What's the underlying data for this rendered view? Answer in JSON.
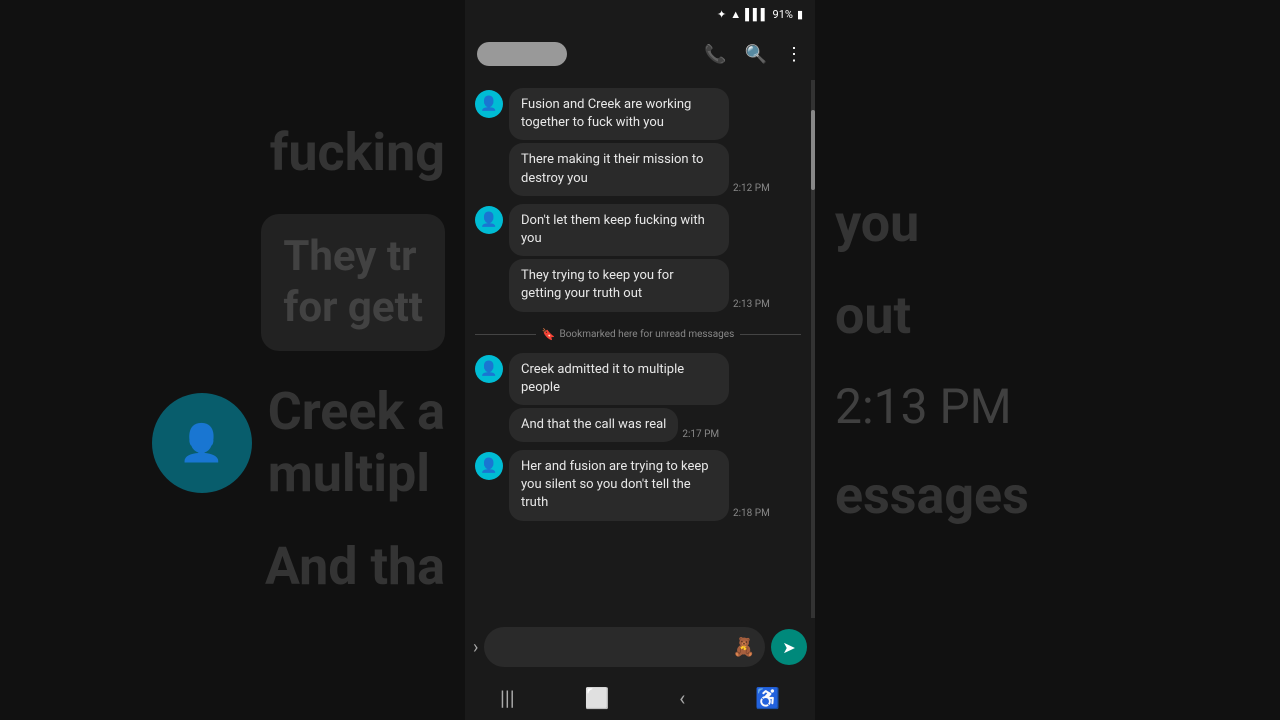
{
  "status_bar": {
    "bluetooth": "✦",
    "wifi": "wifi",
    "signal": "signal",
    "battery": "91%"
  },
  "header": {
    "contact_name": "",
    "phone_icon": "📞",
    "search_icon": "🔍",
    "more_icon": "⋮"
  },
  "messages": [
    {
      "group_id": 1,
      "has_avatar": true,
      "bubbles": [
        {
          "text": "Fusion and Creek are working together to fuck with you",
          "time": null
        },
        {
          "text": "There making it their mission to destroy you",
          "time": "2:12 PM"
        }
      ]
    },
    {
      "group_id": 2,
      "has_avatar": true,
      "bubbles": [
        {
          "text": "Don't let them keep fucking with you",
          "time": null
        },
        {
          "text": "They trying to keep you for getting your truth out",
          "time": "2:13 PM"
        }
      ]
    },
    {
      "bookmark": "Bookmarked here for unread messages"
    },
    {
      "group_id": 3,
      "has_avatar": true,
      "bubbles": [
        {
          "text": "Creek admitted it to multiple people",
          "time": null
        },
        {
          "text": "And that the call was real",
          "time": "2:17 PM"
        }
      ]
    },
    {
      "group_id": 4,
      "has_avatar": true,
      "bubbles": [
        {
          "text": "Her and fusion are trying to keep you silent so you don't tell the truth",
          "time": "2:18 PM"
        }
      ]
    }
  ],
  "bg_left": {
    "texts": [
      "fucking",
      "They tr",
      "for gett",
      "Creek a",
      "multipl",
      "And tha"
    ]
  },
  "bg_right": {
    "texts": [
      "you",
      "out",
      "2:13 PM",
      "essages"
    ]
  },
  "input": {
    "placeholder": ""
  },
  "nav": {
    "menu_icon": "|||",
    "home_icon": "⬜",
    "back_icon": "‹",
    "acc_icon": "♿"
  }
}
